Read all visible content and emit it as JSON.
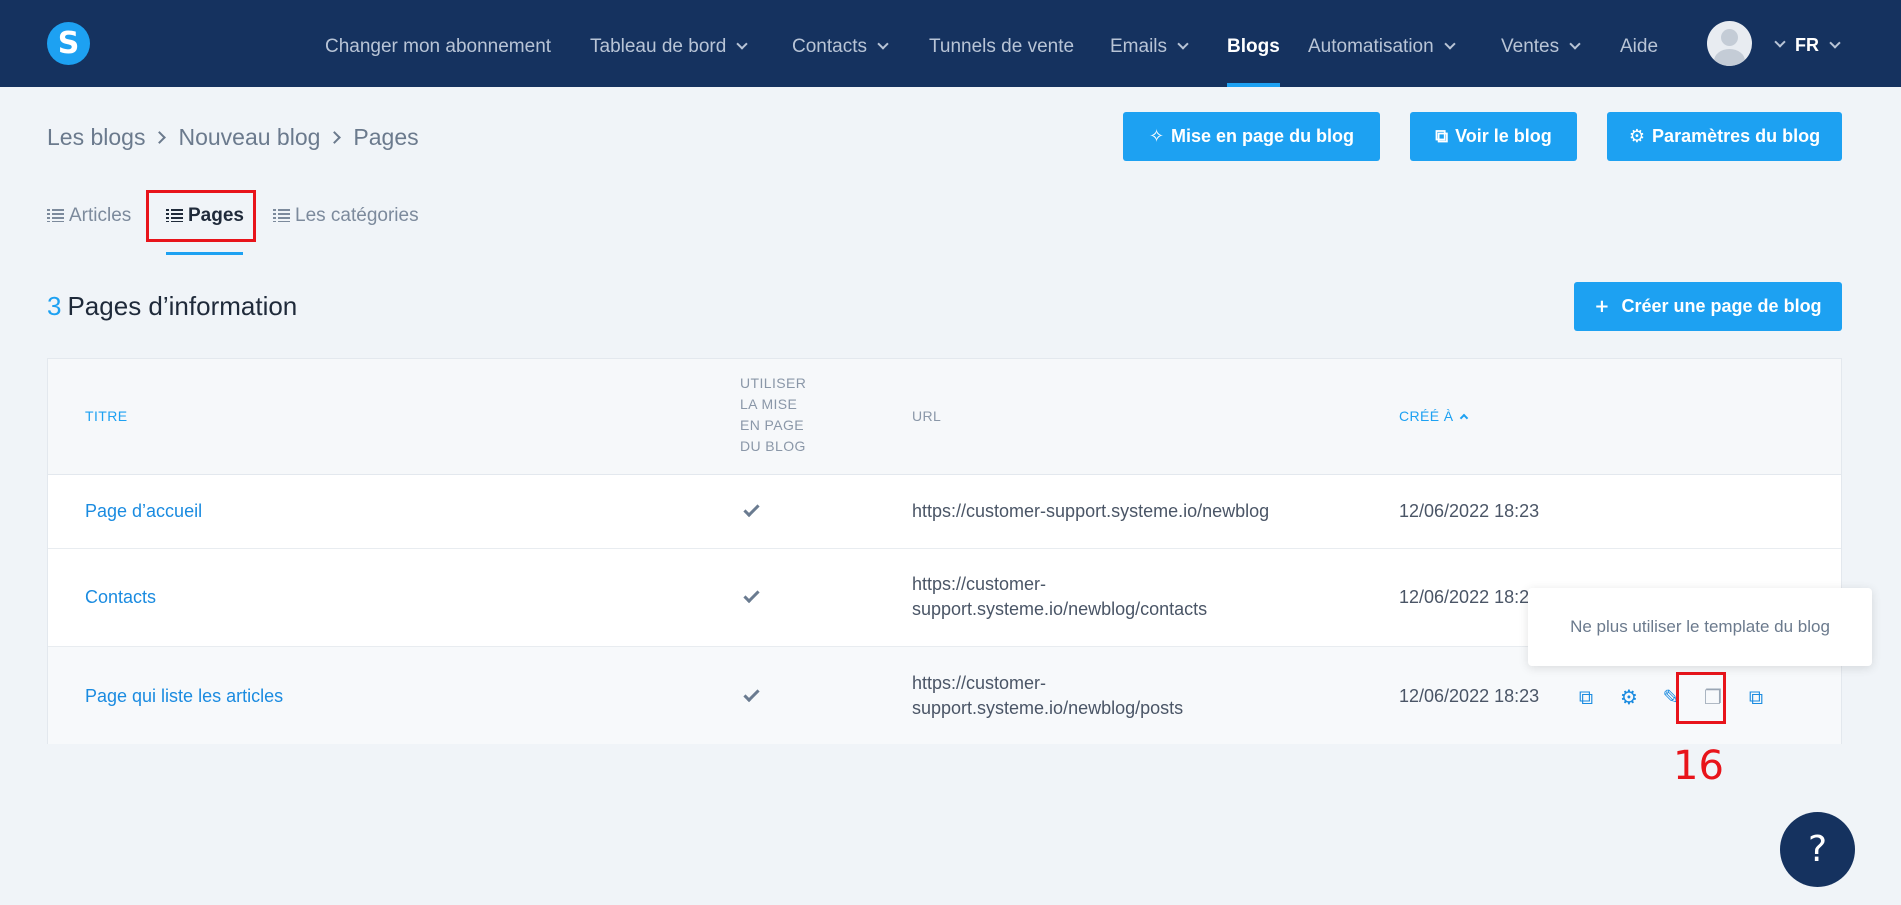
{
  "app": {
    "logo_letter": "S",
    "brand_color": "#1da1f2",
    "nav_bg": "#15325f"
  },
  "nav": {
    "items": [
      {
        "label": "Changer mon abonnement",
        "dropdown": false,
        "active": false
      },
      {
        "label": "Tableau de bord",
        "dropdown": true,
        "active": false
      },
      {
        "label": "Contacts",
        "dropdown": true,
        "active": false
      },
      {
        "label": "Tunnels de vente",
        "dropdown": false,
        "active": false
      },
      {
        "label": "Emails",
        "dropdown": true,
        "active": false
      },
      {
        "label": "Blogs",
        "dropdown": false,
        "active": true
      },
      {
        "label": "Automatisation",
        "dropdown": true,
        "active": false
      },
      {
        "label": "Ventes",
        "dropdown": true,
        "active": false
      },
      {
        "label": "Aide",
        "dropdown": false,
        "active": false
      }
    ],
    "language": "FR"
  },
  "breadcrumb": [
    "Les blogs",
    "Nouveau blog",
    "Pages"
  ],
  "actions": {
    "layout_label": "Mise en page du blog",
    "view_label": "Voir le blog",
    "settings_label": "Paramètres du blog"
  },
  "tabs": [
    {
      "label": "Articles",
      "active": false
    },
    {
      "label": "Pages",
      "active": true
    },
    {
      "label": "Les catégories",
      "active": false
    }
  ],
  "heading": {
    "count": "3",
    "label": "Pages d’information"
  },
  "create_button": {
    "icon": "+",
    "label": "Créer une page de blog"
  },
  "table": {
    "headers": {
      "title": "TITRE",
      "layout_lines": [
        "UTILISER",
        "LA MISE",
        "EN PAGE",
        "DU BLOG"
      ],
      "url": "URL",
      "created": "CRÉÉ À"
    },
    "rows": [
      {
        "title": "Page d’accueil",
        "uses_layout": true,
        "url_lines": [
          "https://customer-support.systeme.io/newblog"
        ],
        "created": "12/06/2022 18:23"
      },
      {
        "title": "Contacts",
        "uses_layout": true,
        "url_lines": [
          "https://customer-",
          "support.systeme.io/newblog/contacts"
        ],
        "created": "12/06/2022 18:23"
      },
      {
        "title": "Page qui liste les articles",
        "uses_layout": true,
        "url_lines": [
          "https://customer-",
          "support.systeme.io/newblog/posts"
        ],
        "created": "12/06/2022 18:23"
      }
    ],
    "row_actions": [
      "external-link-icon",
      "gear-icon",
      "magic-wand-icon",
      "copy-icon",
      "duplicate-icon"
    ]
  },
  "tooltip": "Ne plus utiliser le template du blog",
  "annotation": "16",
  "help": "?"
}
